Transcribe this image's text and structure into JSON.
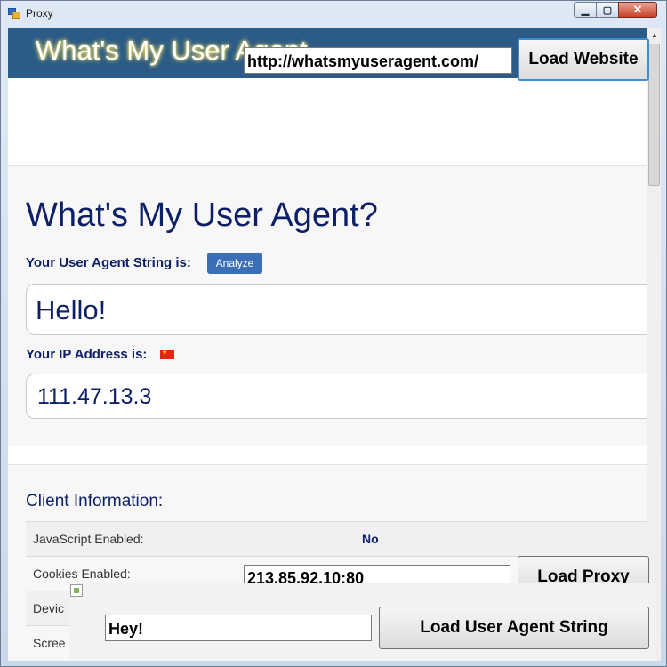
{
  "window": {
    "title": "Proxy",
    "controls": {
      "minimize_icon": "minimize-icon",
      "maximize_icon": "maximize-icon",
      "close_icon": "close-icon"
    }
  },
  "page": {
    "banner_title": "What's My User Agent",
    "main_heading": "What's My User Agent?",
    "ua_label": "Your User Agent String is:",
    "analyze_label": "Analyze",
    "ua_value": "Hello!",
    "ip_label": "Your IP Address is:",
    "ip_value": "111.47.13.3",
    "client_info_title": "Client Information:",
    "client_info_rows": [
      {
        "key": "JavaScript Enabled:",
        "value": "No"
      },
      {
        "key": "Cookies Enabled:",
        "value": ""
      },
      {
        "key": "Devic",
        "value": ""
      },
      {
        "key": "Scree",
        "value": ""
      }
    ]
  },
  "controls": {
    "url_value": "http://whatsmyuseragent.com/",
    "load_website_label": "Load Website",
    "proxy_value": "213.85.92.10:80",
    "load_proxy_label": "Load Proxy",
    "ua_input_value": "Hey!",
    "load_ua_label": "Load User Agent String"
  },
  "colors": {
    "banner": "#2b5b86",
    "heading_text": "#0d1f66",
    "analyze_button": "#3a6eb6",
    "focus_border": "#3c8fd4"
  }
}
